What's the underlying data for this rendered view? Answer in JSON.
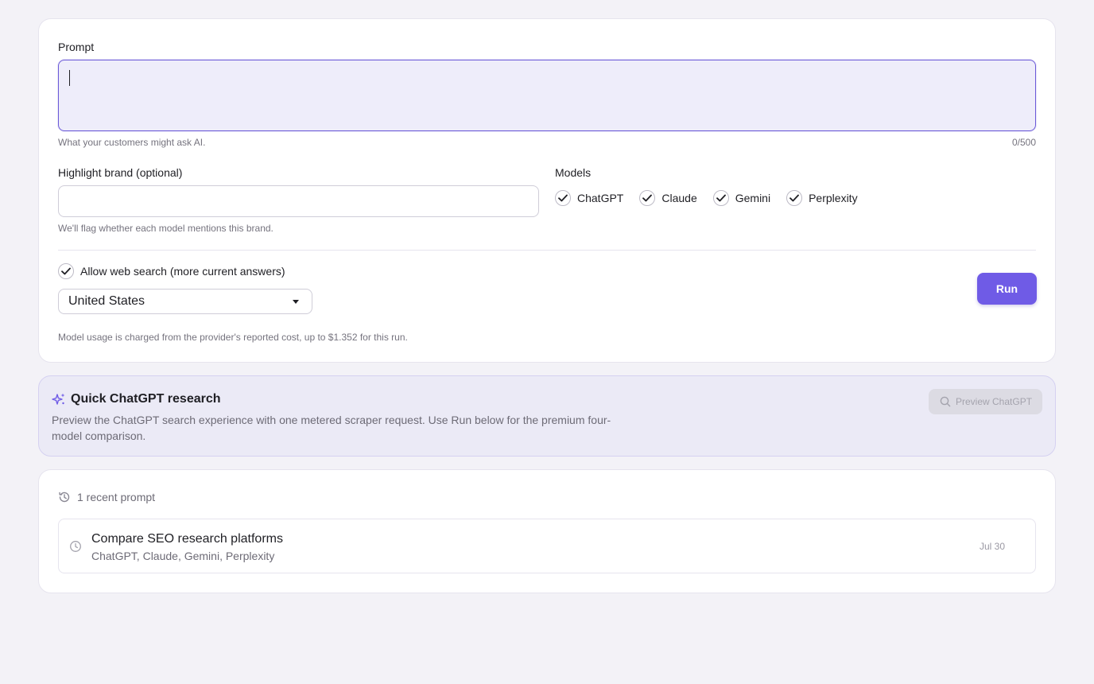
{
  "form": {
    "prompt_label": "Prompt",
    "prompt_value": "",
    "prompt_hint": "What your customers might ask AI.",
    "prompt_counter": "0/500",
    "brand_label": "Highlight brand (optional)",
    "brand_value": "",
    "brand_hint": "We'll flag whether each model mentions this brand.",
    "models_label": "Models",
    "models": [
      {
        "label": "ChatGPT",
        "checked": true
      },
      {
        "label": "Claude",
        "checked": true
      },
      {
        "label": "Gemini",
        "checked": true
      },
      {
        "label": "Perplexity",
        "checked": true
      }
    ],
    "web_search_label": "Allow web search (more current answers)",
    "web_search_checked": true,
    "country_selected": "United States",
    "run_label": "Run",
    "cost_note": "Model usage is charged from the provider's reported cost, up to $1.352 for this run."
  },
  "quick": {
    "title": "Quick ChatGPT research",
    "description": "Preview the ChatGPT search experience with one metered scraper request. Use Run below for the premium four-model comparison.",
    "preview_label": "Preview ChatGPT",
    "icon": "sparkles-icon"
  },
  "recent": {
    "header": "1 recent prompt",
    "items": [
      {
        "title": "Compare SEO research platforms",
        "models": "ChatGPT, Claude, Gemini, Perplexity",
        "date": "Jul 30"
      }
    ]
  },
  "colors": {
    "accent": "#6f5be6",
    "background": "#f3f2f7",
    "prompt_bg": "#eeedfa"
  }
}
